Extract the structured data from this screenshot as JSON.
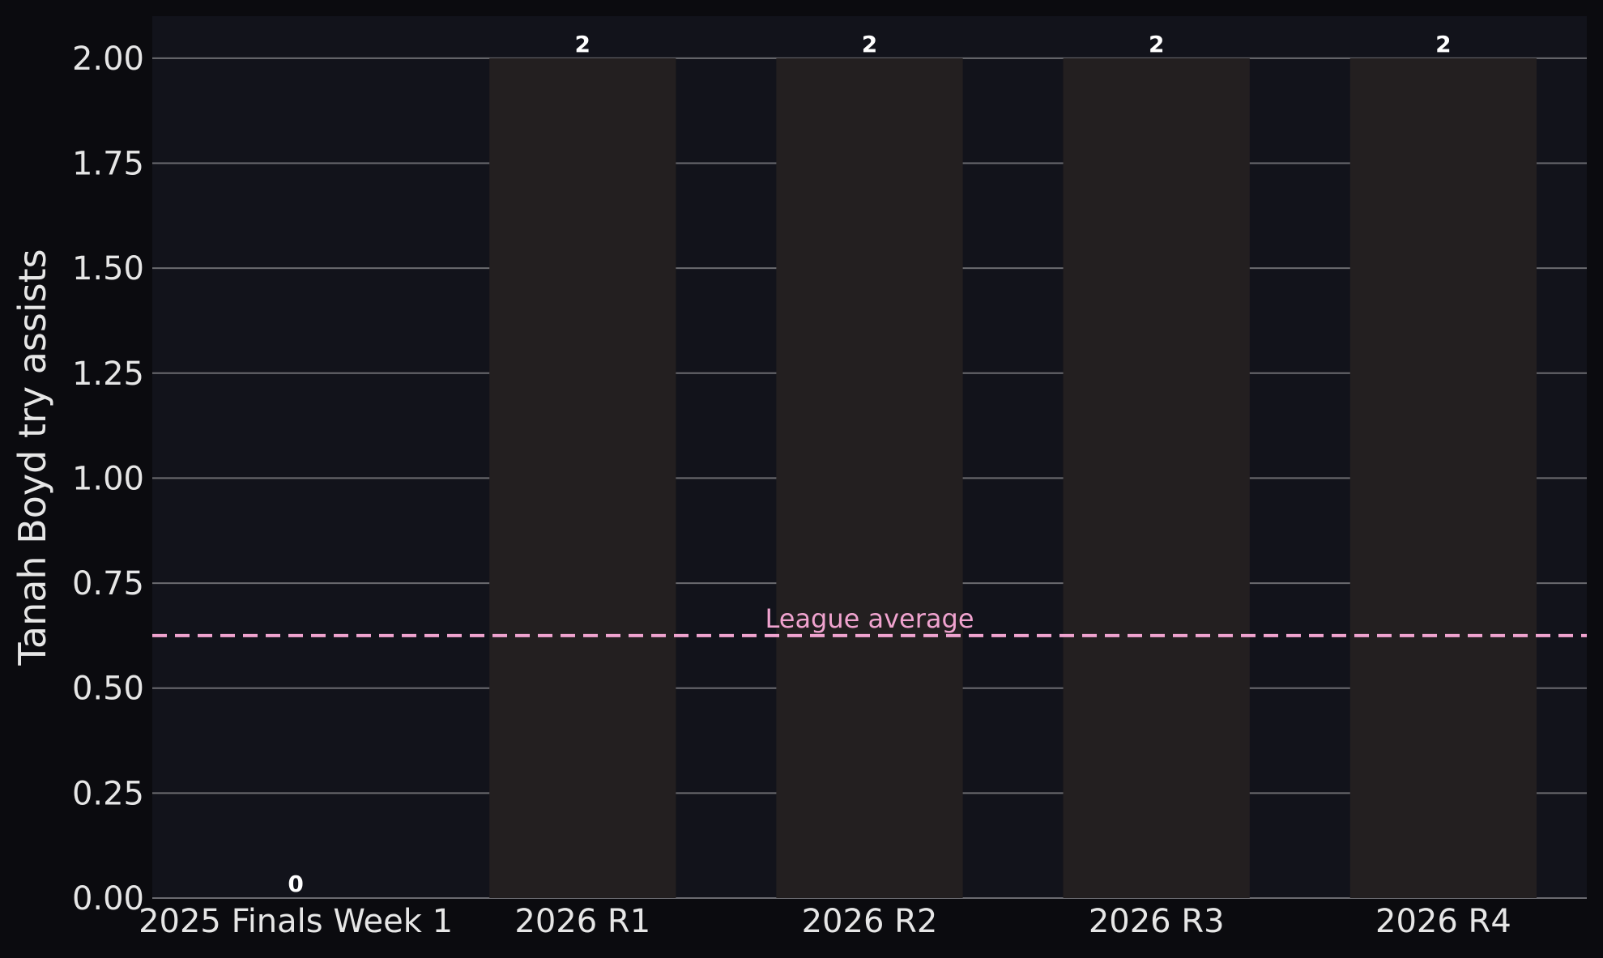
{
  "chart_data": {
    "type": "bar",
    "categories": [
      "2025 Finals Week 1",
      "2026 R1",
      "2026 R2",
      "2026 R3",
      "2026 R4"
    ],
    "values": [
      0,
      2,
      2,
      2,
      2
    ],
    "value_labels": [
      "0",
      "2",
      "2",
      "2",
      "2"
    ],
    "title": "",
    "xlabel": "",
    "ylabel": "Tanah Boyd try assists",
    "ylim": [
      0,
      2.1
    ],
    "yticks": [
      0,
      0.25,
      0.5,
      0.75,
      1.0,
      1.25,
      1.5,
      1.75,
      2.0
    ],
    "ytick_labels": [
      "0.00",
      "0.25",
      "0.50",
      "0.75",
      "1.00",
      "1.25",
      "1.50",
      "1.75",
      "2.00"
    ],
    "grid": "horizontal",
    "reference_line": {
      "label": "League average",
      "value": 0.625,
      "style": "dashed"
    },
    "colors": {
      "page_background": "#0b0b0f",
      "plot_background": "#12131b",
      "bar": "#231f20",
      "grid": "#6b6b70",
      "reference_line": "#f0a3cf",
      "text": "#e6e6e6",
      "bar_label": "#ffffff"
    }
  }
}
